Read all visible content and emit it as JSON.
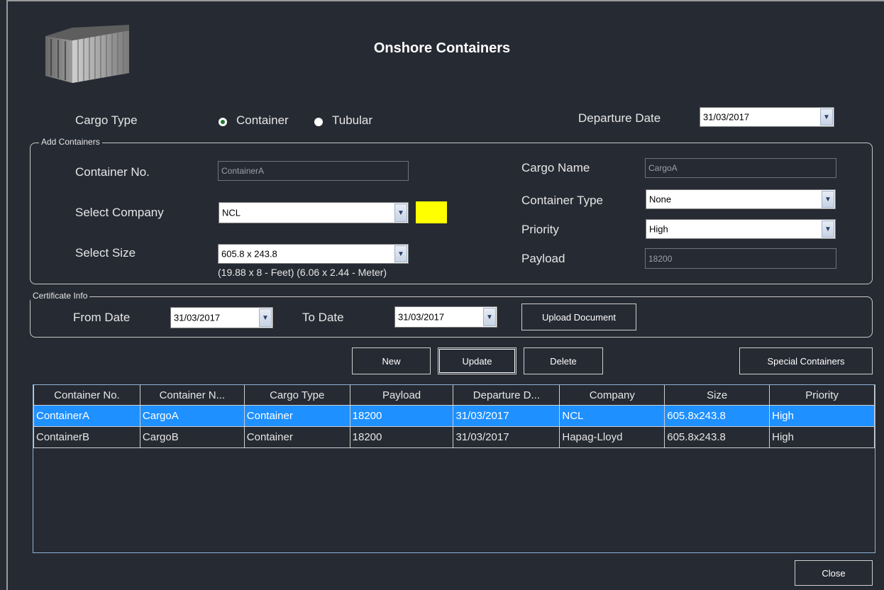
{
  "window": {
    "title": "Onshore Containers"
  },
  "cargo_type": {
    "label": "Cargo Type",
    "options": [
      {
        "label": "Container",
        "selected": true
      },
      {
        "label": "Tubular",
        "selected": false
      }
    ]
  },
  "departure": {
    "label": "Departure Date",
    "value": "31/03/2017"
  },
  "add_containers": {
    "legend": "Add Containers",
    "container_no": {
      "label": "Container No.",
      "placeholder": "ContainerA"
    },
    "company": {
      "label": "Select Company",
      "value": "NCL",
      "color": "#ffff00"
    },
    "size": {
      "label": "Select Size",
      "value": "605.8 x 243.8",
      "note": "(19.88 x 8 - Feet) (6.06 x 2.44 - Meter)"
    },
    "cargo_name": {
      "label": "Cargo Name",
      "placeholder": "CargoA"
    },
    "container_type": {
      "label": "Container Type",
      "value": "None"
    },
    "priority": {
      "label": "Priority",
      "value": "High"
    },
    "payload": {
      "label": "Payload",
      "placeholder": "18200"
    }
  },
  "certificate": {
    "legend": "Certificate Info",
    "from_label": "From Date",
    "from_value": "31/03/2017",
    "to_label": "To Date",
    "to_value": "31/03/2017",
    "upload_label": "Upload Document"
  },
  "actions": {
    "new": "New",
    "update": "Update",
    "delete": "Delete",
    "special": "Special Containers",
    "close": "Close"
  },
  "grid": {
    "columns": [
      "Container No.",
      "Container N...",
      "Cargo Type",
      "Payload",
      "Departure D...",
      "Company",
      "Size",
      "Priority"
    ],
    "rows": [
      [
        "ContainerA",
        "CargoA",
        "Container",
        "18200",
        "31/03/2017",
        "NCL",
        "605.8x243.8",
        "High"
      ],
      [
        "ContainerB",
        "CargoB",
        "Container",
        "18200",
        "31/03/2017",
        "Hapag-Lloyd",
        "605.8x243.8",
        "High"
      ]
    ],
    "selected_row": 0
  },
  "colors": {
    "background": "#262a33",
    "selection": "#1e90ff",
    "company_swatch": "#ffff00"
  }
}
